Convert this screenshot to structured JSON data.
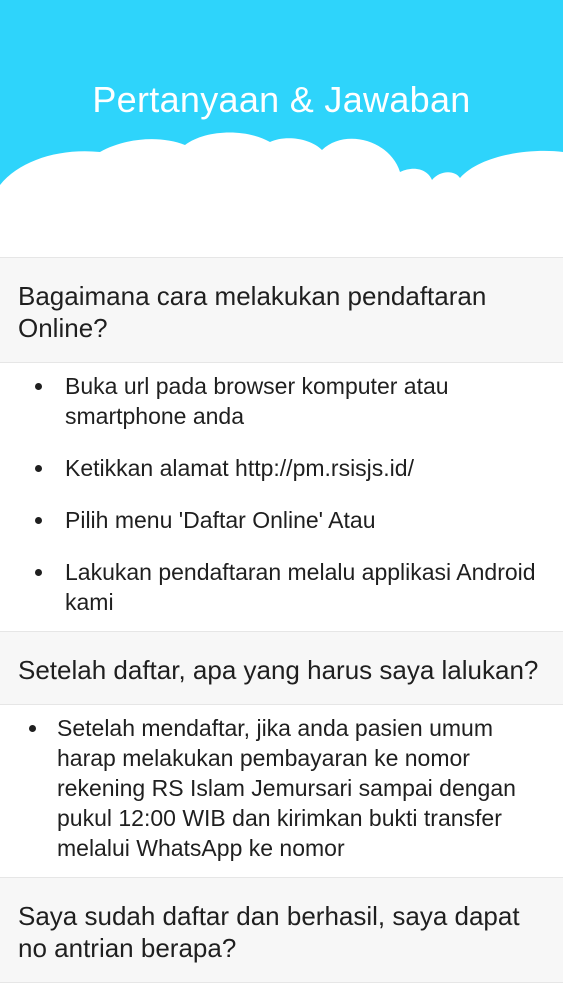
{
  "header": {
    "title": "Pertanyaan & Jawaban",
    "bg_color": "#2ed4fb",
    "cloud_color": "#ffffff"
  },
  "faq": [
    {
      "question": "Bagaimana cara melakukan pendaftaran Online?",
      "answers": [
        "Buka url pada browser komputer atau smartphone anda",
        "Ketikkan alamat http://pm.rsisjs.id/",
        "Pilih menu 'Daftar Online' Atau",
        "Lakukan pendaftaran melalu applikasi Android kami"
      ]
    },
    {
      "question": "Setelah daftar, apa yang harus saya lalukan?",
      "answers": [
        "Setelah mendaftar, jika anda pasien umum harap melakukan pembayaran ke nomor rekening RS Islam Jemursari sampai dengan pukul 12:00 WIB dan kirimkan bukti transfer melalui WhatsApp ke nomor"
      ]
    },
    {
      "question": "Saya sudah daftar dan berhasil, saya dapat no antrian berapa?"
    }
  ]
}
